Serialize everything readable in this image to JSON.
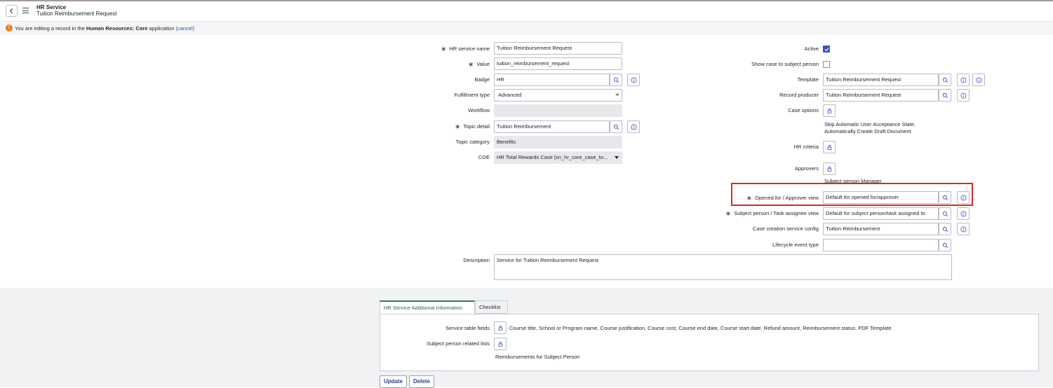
{
  "header": {
    "title": "HR Service",
    "subtitle": "Tuition Reimbursement Request"
  },
  "notice": {
    "prefix": "You are editing a record in the ",
    "app_name": "Human Resources: Core",
    "suffix": " application ",
    "cancel_link": "(cancel)"
  },
  "left_form": {
    "hr_service_name": {
      "label": "HR service name",
      "value": "Tuition Reimbursement Request"
    },
    "value": {
      "label": "Value",
      "value": "tuition_reimbursement_request"
    },
    "badge": {
      "label": "Badge",
      "value": "HR"
    },
    "fulfillment_type": {
      "label": "Fulfillment type",
      "value": "Advanced"
    },
    "workflow": {
      "label": "Workflow",
      "value": ""
    },
    "topic_detail": {
      "label": "Topic detail",
      "value": "Tuition Reimbursement"
    },
    "topic_category": {
      "label": "Topic category",
      "value": "Benefits"
    },
    "coe": {
      "label": "COE",
      "value": "HR Total Rewards Case [sn_hr_core_case_to..."
    },
    "description": {
      "label": "Description",
      "value": "Service for Tuition Reimbursement Request"
    }
  },
  "right_form": {
    "active": {
      "label": "Active",
      "checked": true
    },
    "show_case": {
      "label": "Show case to subject person",
      "checked": false
    },
    "template": {
      "label": "Template",
      "value": "Tuition Reimbursement Request"
    },
    "record_producer": {
      "label": "Record producer",
      "value": "Tuition Reimbursement Request"
    },
    "case_options": {
      "label": "Case options",
      "text_line1": "Skip Automatic User Acceptance State,",
      "text_line2": "Automatically Create Draft Document"
    },
    "hr_criteria": {
      "label": "HR criteria"
    },
    "approvers": {
      "label": "Approvers",
      "text": "Subject person Manager"
    },
    "opened_for": {
      "label": "Opened for / Approver view",
      "value": "Default for opened for/approver"
    },
    "subject_person": {
      "label": "Subject person / Task assignee view",
      "value": "Default for subject person/task assigned to"
    },
    "case_creation": {
      "label": "Case creation service config",
      "value": "Tuition Reimbursement"
    },
    "lifecycle": {
      "label": "Lifecycle event type",
      "value": ""
    }
  },
  "tabs": [
    {
      "label": "HR Service Additional Information",
      "active": true
    },
    {
      "label": "Checklist",
      "active": false
    }
  ],
  "additional_info": {
    "service_table_fields": {
      "label": "Service table fields",
      "value": "Course title, School or Program name, Course justification, Course cost, Course end date, Course start date, Refund amount, Reimbursement status, PDF Template"
    },
    "subject_person_lists": {
      "label": "Subject person related lists",
      "value": "Reimbursements for Subject Person"
    }
  },
  "buttons": {
    "update": "Update",
    "delete": "Delete"
  },
  "required_marker": "∗",
  "icons": {
    "back": "chevron-left-icon",
    "menu": "hamburger-menu-icon",
    "warning": "warning-icon",
    "search": "search-icon",
    "info": "info-icon",
    "lock": "lock-icon"
  },
  "colors": {
    "highlight": "#e0261e",
    "checkbox": "#3b52c2",
    "tab_accent": "#2e7d4f",
    "link": "#2c57a8"
  }
}
